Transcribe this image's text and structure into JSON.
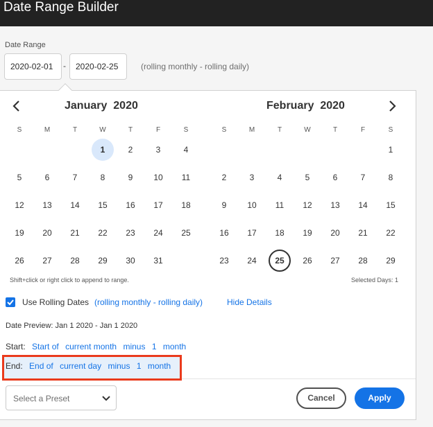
{
  "window": {
    "title": "Date Range Builder"
  },
  "date_range": {
    "label": "Date Range",
    "start": "2020-02-01",
    "separator": "-",
    "end": "2020-02-25",
    "hint": "(rolling monthly - rolling daily)"
  },
  "calendar": {
    "weekdays": [
      "S",
      "M",
      "T",
      "W",
      "T",
      "F",
      "S"
    ],
    "left": {
      "month": "January",
      "year": "2020",
      "days": [
        "1",
        "2",
        "3",
        "4",
        "5",
        "6",
        "7",
        "8",
        "9",
        "10",
        "11",
        "12",
        "13",
        "14",
        "15",
        "16",
        "17",
        "18",
        "19",
        "20",
        "21",
        "22",
        "23",
        "24",
        "25",
        "26",
        "27",
        "28",
        "29",
        "30",
        "31"
      ]
    },
    "right": {
      "month": "February",
      "year": "2020",
      "days": [
        "1",
        "2",
        "3",
        "4",
        "5",
        "6",
        "7",
        "8",
        "9",
        "10",
        "11",
        "12",
        "13",
        "14",
        "15",
        "16",
        "17",
        "18",
        "19",
        "20",
        "21",
        "22",
        "23",
        "24",
        "25",
        "26",
        "27",
        "28",
        "29"
      ]
    },
    "hint": "Shift+click or right click to append to range.",
    "selected_days": "Selected Days: 1"
  },
  "rolling": {
    "label": "Use Rolling Dates",
    "checked": true,
    "description": "(rolling monthly - rolling daily)",
    "hide_details": "Hide Details"
  },
  "preview": {
    "text": "Date Preview: Jan 1 2020 - Jan 1 2020"
  },
  "start_rule": {
    "label": "Start:",
    "anchor": "Start of",
    "unit": "current month",
    "op": "minus",
    "amount": "1",
    "period": "month"
  },
  "end_rule": {
    "label": "End:",
    "anchor": "End of",
    "unit": "current day",
    "op": "minus",
    "amount": "1",
    "period": "month"
  },
  "footer": {
    "preset_placeholder": "Select a Preset",
    "cancel": "Cancel",
    "apply": "Apply"
  },
  "colors": {
    "accent": "#1473e6",
    "highlight": "#ea3a1c",
    "selected_day": "#d9e8fb",
    "titlebar": "#222222"
  }
}
